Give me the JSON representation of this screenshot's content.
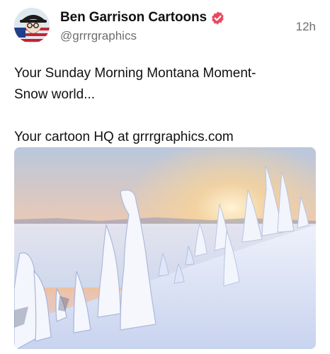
{
  "post": {
    "author": {
      "display_name": "Ben Garrison Cartoons",
      "handle": "@grrrgraphics",
      "avatar_icon": "cartoon-avatar",
      "verified_icon": "verified-badge-icon",
      "verified_color": "#e8495f"
    },
    "timestamp": "12h",
    "text_lines": [
      "Your Sunday Morning Montana Moment-",
      "Snow world...",
      "Your cartoon HQ at grrrgraphics.com"
    ],
    "media": {
      "type": "photo",
      "subject_icon": "snowy-mountain-sunrise-photo"
    }
  }
}
